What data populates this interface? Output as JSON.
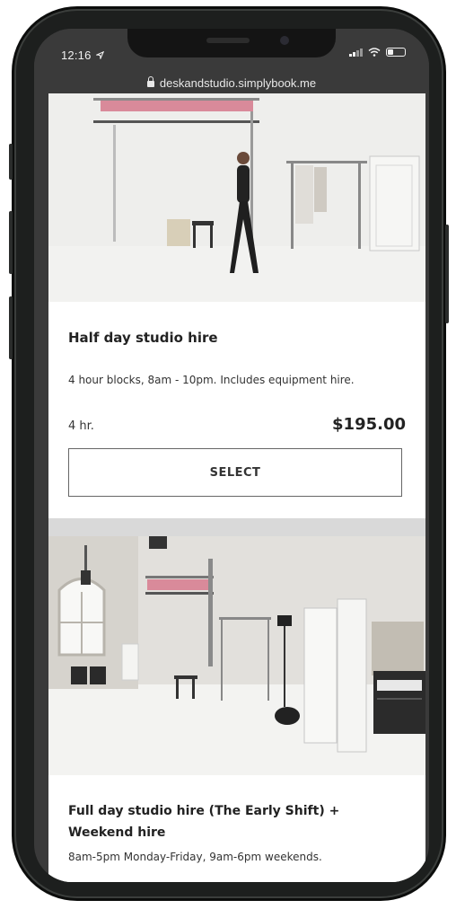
{
  "status_bar": {
    "time": "12:16"
  },
  "browser": {
    "url": "deskandstudio.simplybook.me"
  },
  "services": [
    {
      "title": "Half day studio hire",
      "description": "4 hour blocks, 8am - 10pm. Includes equipment hire.",
      "duration": "4 hr.",
      "price": "$195.00",
      "select_label": "SELECT"
    },
    {
      "title": "Full day studio hire (The Early Shift) + Weekend hire",
      "description": "8am-5pm Monday-Friday, 9am-6pm weekends."
    }
  ],
  "colors": {
    "device_frame": "#1d1f1e",
    "browser_chrome": "#3a3a3a",
    "card_background": "#ffffff",
    "button_border": "#666666"
  }
}
